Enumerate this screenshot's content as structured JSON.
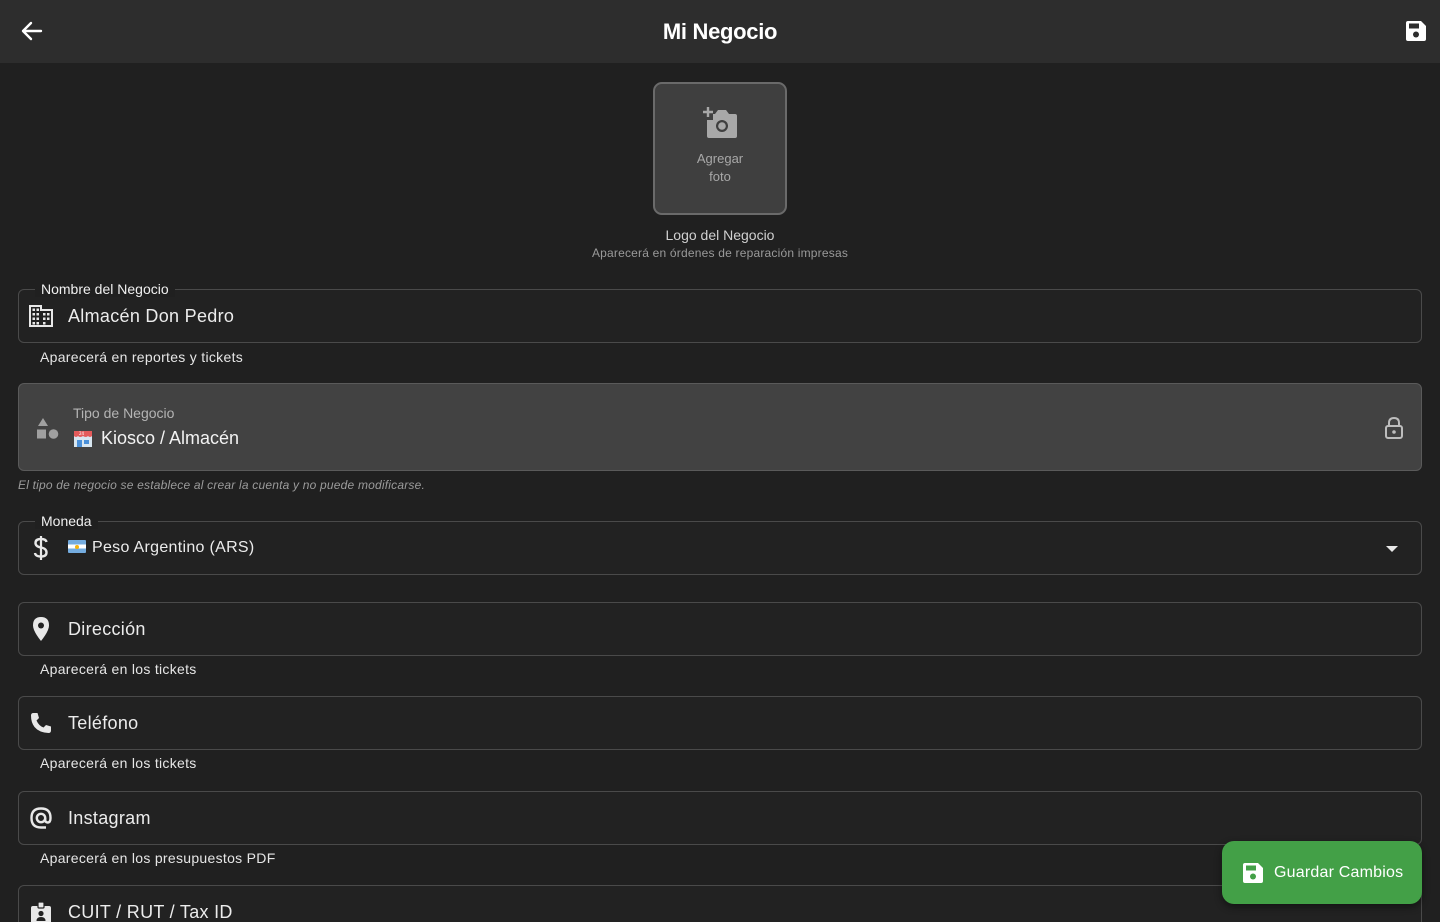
{
  "appbar": {
    "title": "Mi Negocio",
    "back_icon": "arrow-left-icon",
    "save_icon": "floppy-disk-icon"
  },
  "logo": {
    "button_label": "Agregar foto",
    "title": "Logo del Negocio",
    "subtitle": "Aparecerá en órdenes de reparación impresas"
  },
  "business_name": {
    "label": "Nombre del Negocio",
    "value": "Almacén Don Pedro",
    "helper": "Aparecerá en reportes y tickets",
    "icon": "building-icon"
  },
  "business_type": {
    "label": "Tipo de Negocio",
    "value": "Kiosco / Almacén",
    "note": "El tipo de negocio se establece al crear la cuenta y no puede modificarse.",
    "icon": "category-shapes-icon"
  },
  "currency": {
    "label": "Moneda",
    "value": "Peso Argentino (ARS)",
    "icon": "dollar-icon"
  },
  "address": {
    "placeholder": "Dirección",
    "helper": "Aparecerá en los tickets",
    "icon": "location-pin-icon"
  },
  "phone": {
    "placeholder": "Teléfono",
    "helper": "Aparecerá en los tickets",
    "icon": "phone-icon"
  },
  "instagram": {
    "placeholder": "Instagram",
    "helper": "Aparecerá en los presupuestos PDF",
    "icon": "at-sign-icon"
  },
  "tax_id": {
    "placeholder": "CUIT / RUT / Tax ID",
    "icon": "id-badge-icon"
  },
  "fab": {
    "label": "Guardar Cambios"
  },
  "colors": {
    "accent_green": "#43a047",
    "background": "#202020",
    "appbar": "#2d2d2d"
  }
}
